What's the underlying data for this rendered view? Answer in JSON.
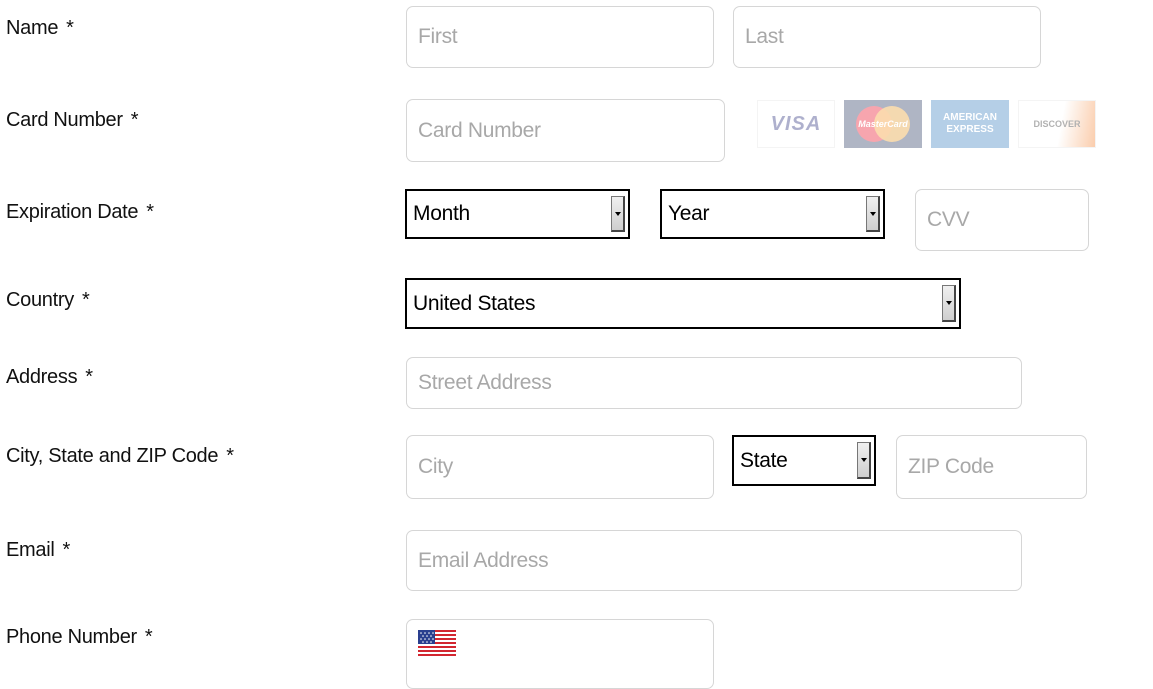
{
  "fields": {
    "name": {
      "label": "Name",
      "required": "*",
      "first_placeholder": "First",
      "last_placeholder": "Last"
    },
    "card_number": {
      "label": "Card Number",
      "required": "*",
      "placeholder": "Card Number"
    },
    "card_logos": {
      "visa": "VISA",
      "mastercard": "MasterCard",
      "amex_line1": "AMERICAN",
      "amex_line2": "EXPRESS",
      "discover": "DISCOVER"
    },
    "expiration": {
      "label": "Expiration Date",
      "required": "*",
      "month_value": "Month",
      "year_value": "Year",
      "cvv_placeholder": "CVV"
    },
    "country": {
      "label": "Country",
      "required": "*",
      "value": "United States"
    },
    "address": {
      "label": "Address",
      "required": "*",
      "placeholder": "Street Address"
    },
    "city_state_zip": {
      "label": "City, State and ZIP Code",
      "required": "*",
      "city_placeholder": "City",
      "state_value": "State",
      "zip_placeholder": "ZIP Code"
    },
    "email": {
      "label": "Email",
      "required": "*",
      "placeholder": "Email Address"
    },
    "phone": {
      "label": "Phone Number",
      "required": "*",
      "flag_icon": "us-flag-icon"
    }
  },
  "colors": {
    "input_border": "#d6d6d6",
    "placeholder": "#a8a8a8",
    "select_border": "#000000",
    "visa_blue": "#1a1f71",
    "mastercard_red": "#eb001b",
    "mastercard_orange": "#f79e1b",
    "amex_blue": "#2e77bb",
    "discover_orange": "#f47216"
  }
}
